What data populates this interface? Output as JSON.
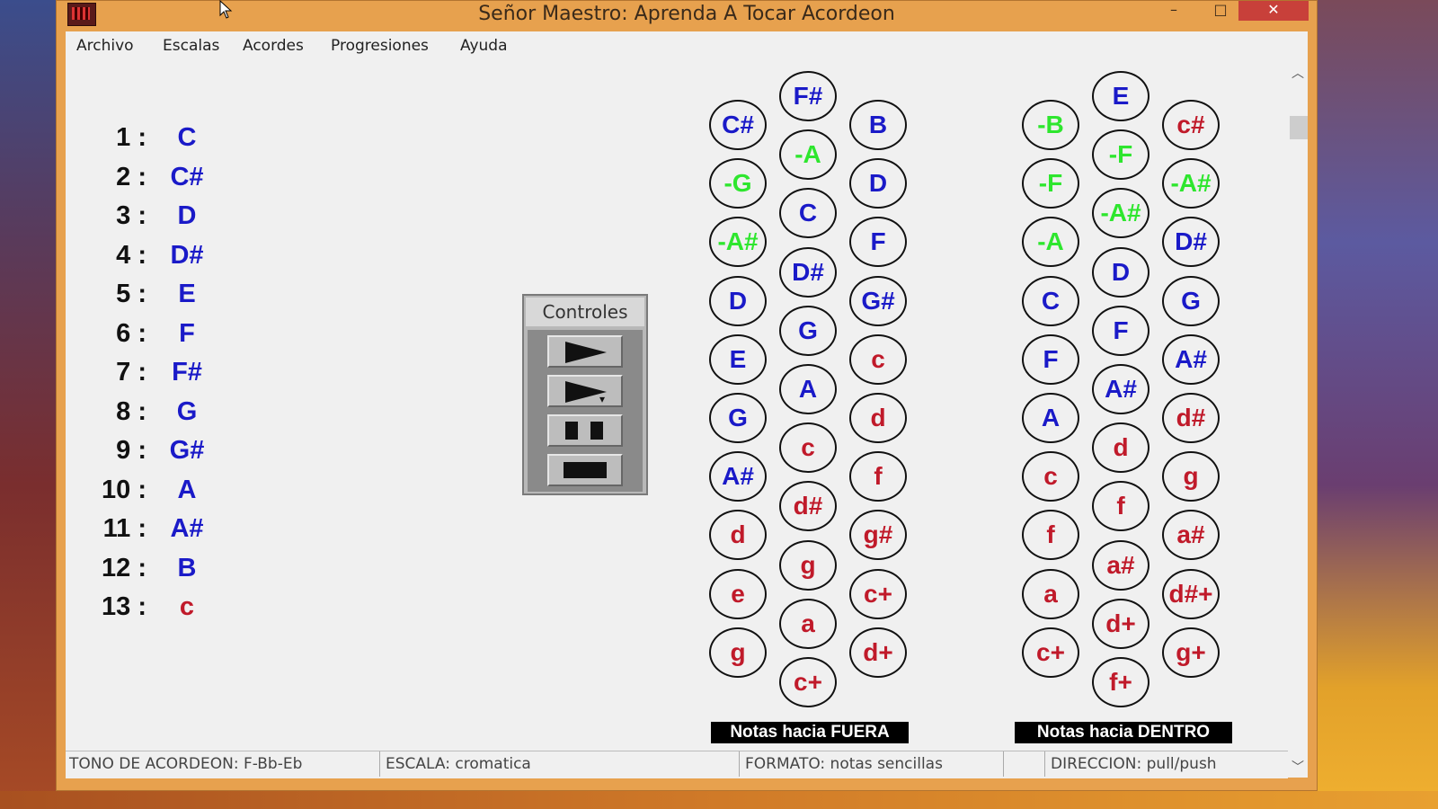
{
  "window": {
    "title": "Señor Maestro: Aprenda A Tocar Acordeon",
    "controls": {
      "minimize": "–",
      "maximize": "□",
      "close": "✕"
    }
  },
  "menu": [
    "Archivo",
    "Escalas",
    "Acordes",
    "Progresiones",
    "Ayuda"
  ],
  "scale": [
    {
      "num": "1 :",
      "note": "C",
      "color": "blue"
    },
    {
      "num": "2 :",
      "note": "C#",
      "color": "blue"
    },
    {
      "num": "3 :",
      "note": "D",
      "color": "blue"
    },
    {
      "num": "4 :",
      "note": "D#",
      "color": "blue"
    },
    {
      "num": "5 :",
      "note": "E",
      "color": "blue"
    },
    {
      "num": "6 :",
      "note": "F",
      "color": "blue"
    },
    {
      "num": "7 :",
      "note": "F#",
      "color": "blue"
    },
    {
      "num": "8 :",
      "note": "G",
      "color": "blue"
    },
    {
      "num": "9 :",
      "note": "G#",
      "color": "blue"
    },
    {
      "num": "10 :",
      "note": "A",
      "color": "blue"
    },
    {
      "num": "11 :",
      "note": "A#",
      "color": "blue"
    },
    {
      "num": "12 :",
      "note": "B",
      "color": "blue"
    },
    {
      "num": "13 :",
      "note": "c",
      "color": "red"
    }
  ],
  "controls_panel": {
    "title": "Controles",
    "buttons": [
      "play-icon",
      "play-step-icon",
      "pause-icon",
      "stop-icon"
    ]
  },
  "colors": {
    "blue": "#1a1ac8",
    "red": "#c01a2a",
    "green": "#2ee62e"
  },
  "keyboard_fuera": {
    "label": "Notas hacia FUERA",
    "left_row": [
      {
        "t": "C#",
        "c": "blue"
      },
      {
        "t": "-G",
        "c": "green"
      },
      {
        "t": "-A#",
        "c": "green"
      },
      {
        "t": "D",
        "c": "blue"
      },
      {
        "t": "E",
        "c": "blue"
      },
      {
        "t": "G",
        "c": "blue"
      },
      {
        "t": "A#",
        "c": "blue"
      },
      {
        "t": "d",
        "c": "red"
      },
      {
        "t": "e",
        "c": "red"
      },
      {
        "t": "g",
        "c": "red"
      }
    ],
    "middle_row": [
      {
        "t": "F#",
        "c": "blue"
      },
      {
        "t": "-A",
        "c": "green"
      },
      {
        "t": "C",
        "c": "blue"
      },
      {
        "t": "D#",
        "c": "blue"
      },
      {
        "t": "G",
        "c": "blue"
      },
      {
        "t": "A",
        "c": "blue"
      },
      {
        "t": "c",
        "c": "red"
      },
      {
        "t": "d#",
        "c": "red"
      },
      {
        "t": "g",
        "c": "red"
      },
      {
        "t": "a",
        "c": "red"
      },
      {
        "t": "c+",
        "c": "red"
      }
    ],
    "right_row": [
      {
        "t": "B",
        "c": "blue"
      },
      {
        "t": "D",
        "c": "blue"
      },
      {
        "t": "F",
        "c": "blue"
      },
      {
        "t": "G#",
        "c": "blue"
      },
      {
        "t": "c",
        "c": "red"
      },
      {
        "t": "d",
        "c": "red"
      },
      {
        "t": "f",
        "c": "red"
      },
      {
        "t": "g#",
        "c": "red"
      },
      {
        "t": "c+",
        "c": "red"
      },
      {
        "t": "d+",
        "c": "red"
      }
    ]
  },
  "keyboard_dentro": {
    "label": "Notas hacia DENTRO",
    "left_row": [
      {
        "t": "-B",
        "c": "green"
      },
      {
        "t": "-F",
        "c": "green"
      },
      {
        "t": "-A",
        "c": "green"
      },
      {
        "t": "C",
        "c": "blue"
      },
      {
        "t": "F",
        "c": "blue"
      },
      {
        "t": "A",
        "c": "blue"
      },
      {
        "t": "c",
        "c": "red"
      },
      {
        "t": "f",
        "c": "red"
      },
      {
        "t": "a",
        "c": "red"
      },
      {
        "t": "c+",
        "c": "red"
      }
    ],
    "middle_row": [
      {
        "t": "E",
        "c": "blue"
      },
      {
        "t": "-F",
        "c": "green"
      },
      {
        "t": "-A#",
        "c": "green"
      },
      {
        "t": "D",
        "c": "blue"
      },
      {
        "t": "F",
        "c": "blue"
      },
      {
        "t": "A#",
        "c": "blue"
      },
      {
        "t": "d",
        "c": "red"
      },
      {
        "t": "f",
        "c": "red"
      },
      {
        "t": "a#",
        "c": "red"
      },
      {
        "t": "d+",
        "c": "red"
      },
      {
        "t": "f+",
        "c": "red"
      }
    ],
    "right_row": [
      {
        "t": "c#",
        "c": "red"
      },
      {
        "t": "-A#",
        "c": "green"
      },
      {
        "t": "D#",
        "c": "blue"
      },
      {
        "t": "G",
        "c": "blue"
      },
      {
        "t": "A#",
        "c": "blue"
      },
      {
        "t": "d#",
        "c": "red"
      },
      {
        "t": "g",
        "c": "red"
      },
      {
        "t": "a#",
        "c": "red"
      },
      {
        "t": "d#+",
        "c": "red"
      },
      {
        "t": "g+",
        "c": "red"
      }
    ]
  },
  "status": {
    "tono": "TONO DE ACORDEON: F-Bb-Eb",
    "escala": "ESCALA: cromatica",
    "formato": "FORMATO: notas sencillas",
    "empty": "",
    "direccion": "DIRECCION: pull/push"
  }
}
